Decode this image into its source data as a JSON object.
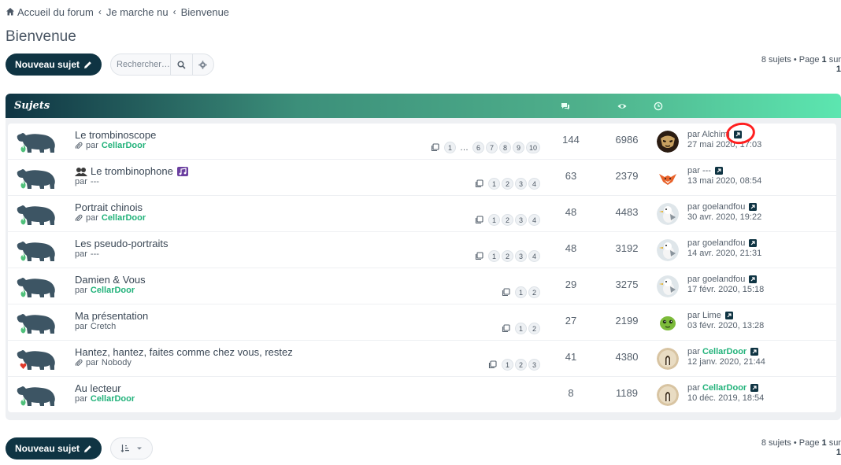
{
  "breadcrumb": {
    "items": [
      "Accueil du forum",
      "Je marche nu",
      "Bienvenue"
    ]
  },
  "page_title": "Bienvenue",
  "toolbar": {
    "new_topic_label": "Nouveau sujet",
    "search_placeholder": "Rechercher…"
  },
  "pagination": {
    "count_text": "8 sujets",
    "page_word": "Page",
    "current": "1",
    "of_word": "sur",
    "total": "1"
  },
  "panel": {
    "header_label": "Sujets"
  },
  "colors": {
    "accent_dark": "#0f3443",
    "accent_green": "#21b27a",
    "header_gradient_end": "#5ce6b0",
    "highlight_red": "#ff1f1f"
  },
  "topics": [
    {
      "title": "Le trombinoscope",
      "by": "par",
      "author": "CellarDoor",
      "author_colored": true,
      "has_attachment": true,
      "pages": [
        "1",
        "…",
        "6",
        "7",
        "8",
        "9",
        "10"
      ],
      "replies": "144",
      "views": "6986",
      "last_by": "par",
      "last_author": "Alchimi",
      "last_author_colored": false,
      "last_date": "27 mai 2020, 17:03",
      "avatar": "mask"
    },
    {
      "title": "Le trombinophone",
      "by": "par",
      "author": "---",
      "author_colored": false,
      "has_attachment": false,
      "pages": [
        "1",
        "2",
        "3",
        "4"
      ],
      "replies": "63",
      "views": "2379",
      "last_by": "par",
      "last_author": "---",
      "last_author_colored": false,
      "last_date": "13 mai 2020, 08:54",
      "avatar": "fox"
    },
    {
      "title": "Portrait chinois",
      "by": "par",
      "author": "CellarDoor",
      "author_colored": true,
      "has_attachment": true,
      "pages": [
        "1",
        "2",
        "3",
        "4"
      ],
      "replies": "48",
      "views": "4483",
      "last_by": "par",
      "last_author": "goelandfou",
      "last_author_colored": false,
      "last_date": "30 avr. 2020, 19:22",
      "avatar": "gull"
    },
    {
      "title": "Les pseudo-portraits",
      "by": "par",
      "author": "---",
      "author_colored": false,
      "has_attachment": false,
      "pages": [
        "1",
        "2",
        "3",
        "4"
      ],
      "replies": "48",
      "views": "3192",
      "last_by": "par",
      "last_author": "goelandfou",
      "last_author_colored": false,
      "last_date": "14 avr. 2020, 21:31",
      "avatar": "gull"
    },
    {
      "title": "Damien & Vous",
      "by": "par",
      "author": "CellarDoor",
      "author_colored": true,
      "has_attachment": false,
      "pages": [
        "1",
        "2"
      ],
      "replies": "29",
      "views": "3275",
      "last_by": "par",
      "last_author": "goelandfou",
      "last_author_colored": false,
      "last_date": "17 févr. 2020, 15:18",
      "avatar": "gull"
    },
    {
      "title": "Ma présentation",
      "by": "par",
      "author": "Cretch",
      "author_colored": false,
      "has_attachment": false,
      "pages": [
        "1",
        "2"
      ],
      "replies": "27",
      "views": "2199",
      "last_by": "par",
      "last_author": "Lime",
      "last_author_colored": false,
      "last_date": "03 févr. 2020, 13:28",
      "avatar": "lime"
    },
    {
      "title": "Hantez, hantez, faites comme chez vous, restez",
      "by": "par",
      "author": "Nobody",
      "author_colored": false,
      "has_attachment": true,
      "pages": [
        "1",
        "2",
        "3"
      ],
      "replies": "41",
      "views": "4380",
      "last_by": "par",
      "last_author": "CellarDoor",
      "last_author_colored": true,
      "last_date": "12 janv. 2020, 21:44",
      "avatar": "cellar"
    },
    {
      "title": "Au lecteur",
      "by": "par",
      "author": "CellarDoor",
      "author_colored": true,
      "has_attachment": false,
      "pages": [],
      "replies": "8",
      "views": "1189",
      "last_by": "par",
      "last_author": "CellarDoor",
      "last_author_colored": true,
      "last_date": "10 déc. 2019, 18:54",
      "avatar": "cellar"
    }
  ]
}
